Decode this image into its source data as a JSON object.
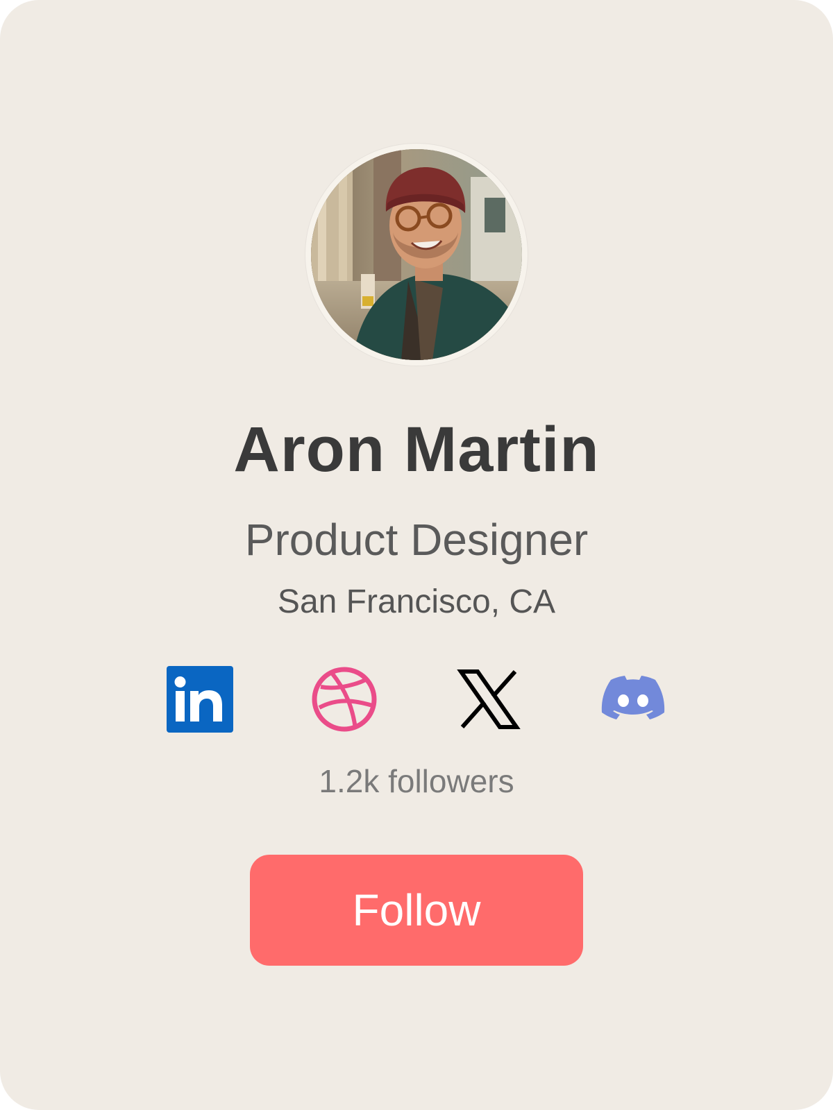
{
  "profile": {
    "name": "Aron Martin",
    "role": "Product Designer",
    "location": "San Francisco, CA",
    "followers": "1.2k followers"
  },
  "social_links": [
    {
      "name": "linkedin",
      "icon": "linkedin-icon",
      "color": "#0a66c2"
    },
    {
      "name": "dribbble",
      "icon": "dribbble-icon",
      "color": "#ea4c89"
    },
    {
      "name": "x",
      "icon": "x-icon",
      "color": "#000000"
    },
    {
      "name": "discord",
      "icon": "discord-icon",
      "color": "#7289da"
    }
  ],
  "actions": {
    "follow_label": "Follow",
    "follow_color": "#ff6b6b"
  },
  "theme": {
    "card_background": "#f0ebe4"
  }
}
